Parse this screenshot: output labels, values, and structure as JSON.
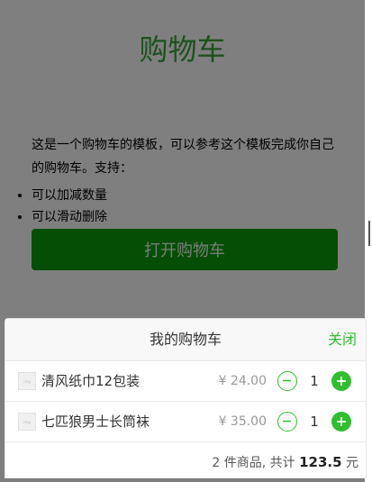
{
  "page": {
    "title": "购物车",
    "description": "这是一个购物车的模板，可以参考这个模板完成你自己的购物车。支持：",
    "features": [
      "可以加减数量",
      "可以滑动删除"
    ],
    "open_button": "打开购物车"
  },
  "cart": {
    "title": "我的购物车",
    "close_label": "关闭",
    "items": [
      {
        "thumb": "img",
        "name": "清风纸巾12包装",
        "price": "¥ 24.00",
        "quantity": "1"
      },
      {
        "thumb": "img",
        "name": "七匹狼男士长筒袜",
        "price": "¥ 35.00",
        "quantity": "1"
      }
    ],
    "summary": {
      "count_text": "2 件商品, 共计",
      "total": "123.5",
      "unit": "元"
    }
  },
  "colors": {
    "accent": "#2fbf2f",
    "title_green": "#3aa53a",
    "button_green": "#0a9c0a"
  },
  "icons": [
    "minus-circle-icon",
    "plus-circle-icon",
    "product-thumbnail-icon"
  ]
}
